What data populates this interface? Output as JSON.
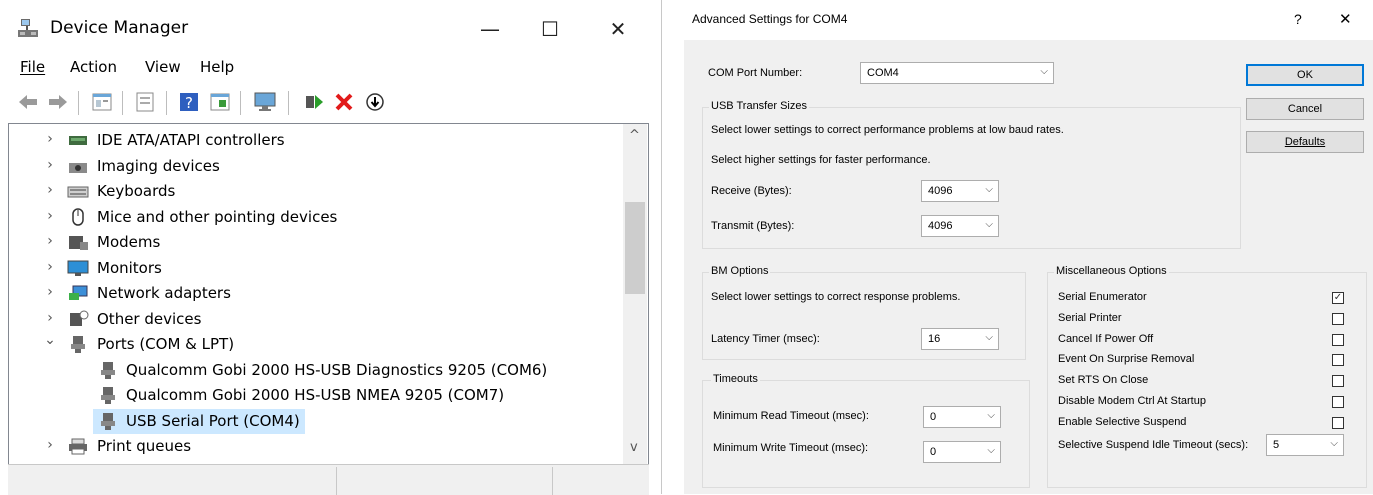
{
  "device_manager": {
    "title": "Device Manager",
    "window_controls": {
      "minimize": "—",
      "maximize": "☐",
      "close": "✕"
    },
    "menu": [
      "File",
      "Action",
      "View",
      "Help"
    ],
    "tree": [
      {
        "label": "IDE ATA/ATAPI controllers",
        "chev": "›",
        "icon": "ide-controller-icon"
      },
      {
        "label": "Imaging devices",
        "chev": "›",
        "icon": "camera-icon"
      },
      {
        "label": "Keyboards",
        "chev": "›",
        "icon": "keyboard-icon"
      },
      {
        "label": "Mice and other pointing devices",
        "chev": "›",
        "icon": "mouse-icon"
      },
      {
        "label": "Modems",
        "chev": "›",
        "icon": "modem-icon"
      },
      {
        "label": "Monitors",
        "chev": "›",
        "icon": "monitor-icon"
      },
      {
        "label": "Network adapters",
        "chev": "›",
        "icon": "network-icon"
      },
      {
        "label": "Other devices",
        "chev": "›",
        "icon": "unknown-device-icon"
      },
      {
        "label": "Ports (COM & LPT)",
        "chev": "⌄",
        "icon": "port-icon"
      },
      {
        "label": "Qualcomm Gobi 2000 HS-USB Diagnostics 9205 (COM6)",
        "icon": "port-icon"
      },
      {
        "label": "Qualcomm Gobi 2000 HS-USB NMEA 9205 (COM7)",
        "icon": "port-icon"
      },
      {
        "label": "USB Serial Port (COM4)",
        "icon": "port-icon",
        "selected": true
      },
      {
        "label": "Print queues",
        "chev": "›",
        "icon": "printer-icon"
      }
    ],
    "scroll_up": "^",
    "scroll_down": "v"
  },
  "dialog": {
    "title": "Advanced Settings for COM4",
    "help": "?",
    "close": "✕",
    "com_port_label": "COM Port Number:",
    "com_port_value": "COM4",
    "usb_group": "USB Transfer Sizes",
    "usb_text1": "Select lower settings to correct performance problems at low baud rates.",
    "usb_text2": "Select higher settings for faster performance.",
    "receive_label": "Receive (Bytes):",
    "receive_value": "4096",
    "transmit_label": "Transmit (Bytes):",
    "transmit_value": "4096",
    "bm_group": "BM Options",
    "bm_text": "Select lower settings to correct response problems.",
    "latency_label": "Latency Timer (msec):",
    "latency_value": "16",
    "timeouts_group": "Timeouts",
    "min_read_label": "Minimum Read Timeout (msec):",
    "min_read_value": "0",
    "min_write_label": "Minimum Write Timeout (msec):",
    "min_write_value": "0",
    "misc_group": "Miscellaneous Options",
    "misc_options": [
      {
        "label": "Serial Enumerator",
        "checked": true
      },
      {
        "label": "Serial Printer",
        "checked": false
      },
      {
        "label": "Cancel If Power Off",
        "checked": false
      },
      {
        "label": "Event On Surprise Removal",
        "checked": false
      },
      {
        "label": "Set RTS On Close",
        "checked": false
      },
      {
        "label": "Disable Modem Ctrl At Startup",
        "checked": false
      },
      {
        "label": "Enable Selective Suspend",
        "checked": false
      }
    ],
    "suspend_label": "Selective Suspend Idle Timeout (secs):",
    "suspend_value": "5",
    "ok": "OK",
    "cancel": "Cancel",
    "defaults": "Defaults",
    "check_glyph": "✓",
    "dropdown_glyph": "⌵"
  }
}
